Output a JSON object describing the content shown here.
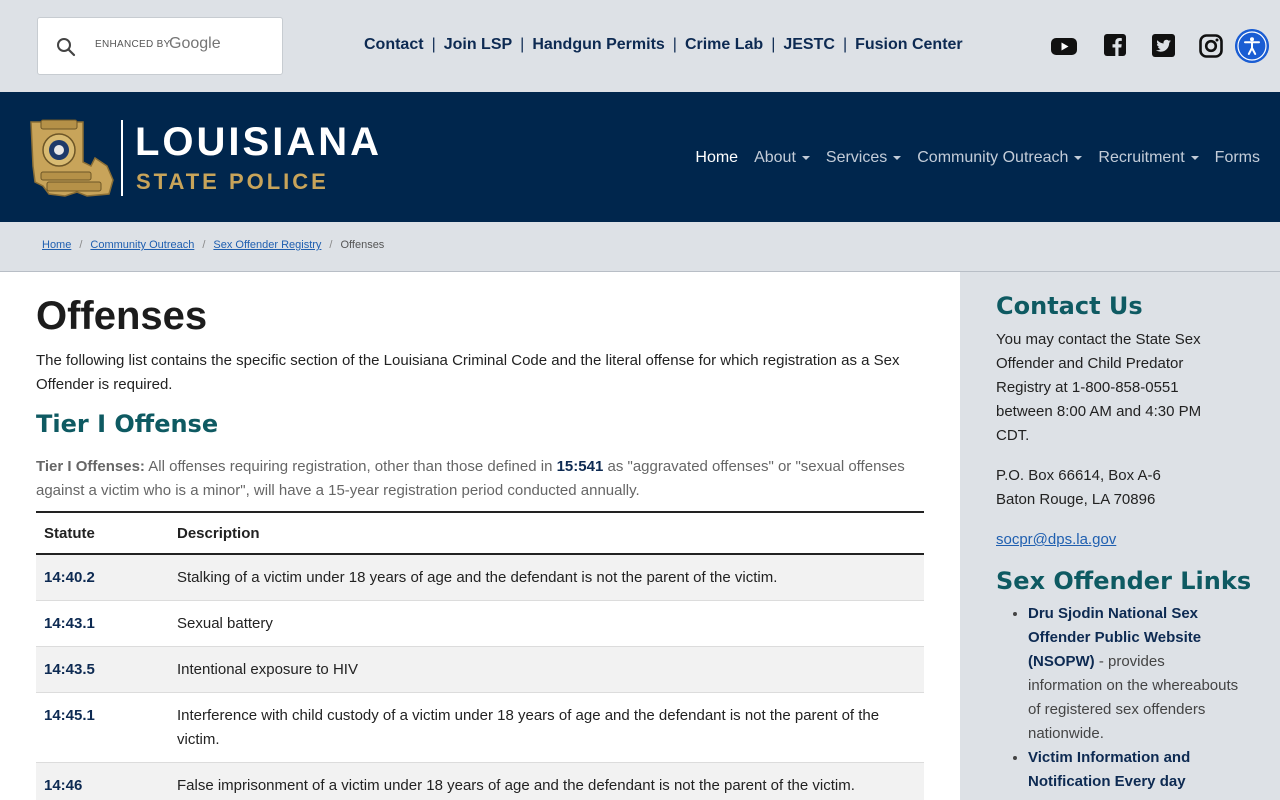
{
  "search": {
    "enhanced_label": "ENHANCED BY",
    "brand": "Google"
  },
  "quick_links": [
    "Contact",
    "Join LSP",
    "Handgun Permits",
    "Crime Lab",
    "JESTC",
    "Fusion Center"
  ],
  "social_icons": [
    "youtube-icon",
    "facebook-icon",
    "twitter-icon",
    "instagram-icon"
  ],
  "accessibility_icon": "accessibility-icon",
  "logo": {
    "line1": "LOUISIANA",
    "line2": "STATE POLICE",
    "gold": "#c8a45a"
  },
  "nav": [
    {
      "label": "Home",
      "dropdown": false
    },
    {
      "label": "About",
      "dropdown": true
    },
    {
      "label": "Services",
      "dropdown": true
    },
    {
      "label": "Community Outreach",
      "dropdown": true
    },
    {
      "label": "Recruitment",
      "dropdown": true
    },
    {
      "label": "Forms",
      "dropdown": false
    }
  ],
  "breadcrumb": {
    "home": "Home",
    "community": "Community Outreach",
    "registry": "Sex Offender Registry",
    "current": "Offenses"
  },
  "main": {
    "title": "Offenses",
    "intro": "The following list contains the specific section of the Louisiana Criminal Code and the literal offense for which registration as a Sex Offender is required.",
    "tier_heading": "Tier I Offense",
    "tier_label": "Tier I Offenses:",
    "tier_text_a": " All offenses requiring registration, other than those defined in ",
    "tier_link": "15:541",
    "tier_text_b": " as \"aggravated offenses\" or \"sexual offenses against a victim who is a minor\", will have a 15-year registration period conducted annually."
  },
  "table": {
    "headers": {
      "statute": "Statute",
      "description": "Description"
    },
    "rows": [
      {
        "statute": "14:40.2",
        "description": "Stalking of a victim under 18 years of age and the defendant is not the parent of the victim."
      },
      {
        "statute": "14:43.1",
        "description": "Sexual battery"
      },
      {
        "statute": "14:43.5",
        "description": "Intentional exposure to HIV"
      },
      {
        "statute": "14:45.1",
        "description": "Interference with child custody of a victim under 18 years of age and the defendant is not the parent of the victim."
      },
      {
        "statute": "14:46",
        "description": "False imprisonment of a victim under 18 years of age and the defendant is not the parent of the victim."
      }
    ]
  },
  "sidebar": {
    "contact_heading": "Contact Us",
    "contact_text": "You may contact the State Sex Offender and Child Predator Registry at 1-800-858-0551 between 8:00 AM and 4:30 PM CDT.",
    "address_line1": "P.O. Box 66614, Box A-6",
    "address_line2": "Baton Rouge, LA 70896",
    "email": "socpr@dps.la.gov",
    "links_heading": "Sex Offender Links",
    "links": [
      {
        "label": "Dru Sjodin National Sex Offender Public Website (NSOPW)",
        "text": " - provides information on the whereabouts of registered sex offenders nationwide."
      },
      {
        "label": "Victim Information and Notification Every day",
        "text": ""
      }
    ]
  }
}
